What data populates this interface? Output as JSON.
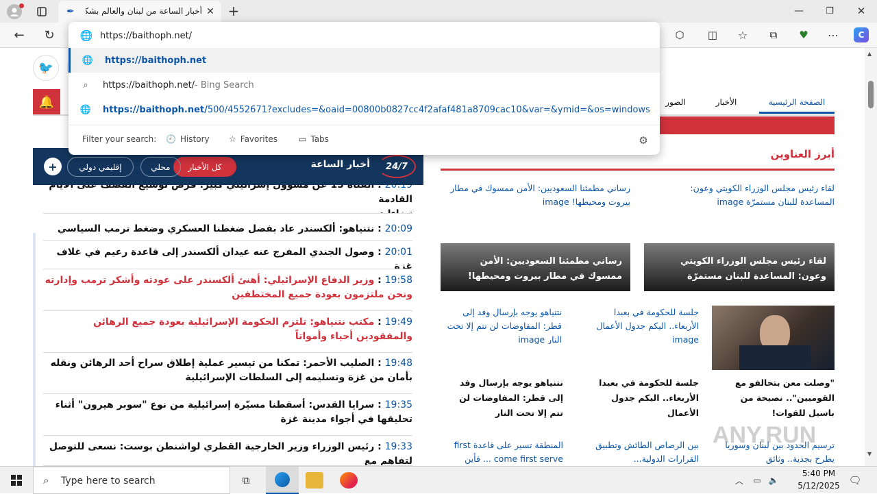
{
  "browser": {
    "tab_title": "أخبار الساعة من لبنان والعالم بشكل",
    "address_value": "https://baithoph.net/"
  },
  "suggestions": [
    {
      "text": "https://baithoph.net",
      "icon": "globe-icon",
      "bold": true
    },
    {
      "text": "https://baithoph.net/",
      "suffix": " - Bing Search",
      "icon": "search-icon"
    },
    {
      "text": "https://baithoph.net/",
      "rest": "500/4552671?excludes=&oaid=00800b0827cc4f2afaf481a8709cac10&var=&ymid=&os=windows&os_v...",
      "icon": "globe-icon"
    }
  ],
  "filter": {
    "label": "Filter your search:",
    "history": "History",
    "favorites": "Favorites",
    "tabs": "Tabs"
  },
  "site": {
    "nav": [
      "الصفحة الرئيسية",
      "الأخبار",
      "الصور"
    ],
    "live_title": "أخبار الساعة",
    "live_badge": "24/7",
    "filters": [
      "كل الأخبار",
      "محلي",
      "إقليمي دولي"
    ],
    "headlines_title": "أبرز العناوين"
  },
  "feed": [
    {
      "time": "20:09",
      "text": "نتنياهو: ألكسندر عاد بفضل ضغطنا العسكري وضغط ترمب السياسي",
      "red": false
    },
    {
      "time": "20:01",
      "text": "وصول الجندي المفرج عنه عيدان ألكسندر إلى قاعدة رعيم في غلاف غزة",
      "red": false
    },
    {
      "time": "19:58",
      "text": "وزير الدفاع الإسرائيلي: أهنئ ألكسندر على عودته وأشكر ترمب وإدارته ونحن ملتزمون بعودة جميع المختطفين",
      "red": true
    },
    {
      "time": "19:49",
      "text": "مكتب نتنياهو: تلتزم الحكومة الإسرائيلية بعودة جميع الرهائن والمفقودين أحياء وأمواتاً",
      "red": true
    },
    {
      "time": "19:48",
      "text": "الصليب الأحمر: تمكنا من تيسير عملية إطلاق سراح أحد الرهائن ونقله بأمان من غزة وتسليمه إلى السلطات الإسرائيلية",
      "red": false
    },
    {
      "time": "19:35",
      "text": "سرايا القدس: أسقطنا مسيّرة إسرائيلية من نوع \"سوبر هيرون\" أثناء تحليقها في أجواء مدينة غزة",
      "red": false
    },
    {
      "time": "19:33",
      "text": "رئيس الوزراء وزير الخارجية القطري لواشنطن بوست: نسعى للتوصل لتفاهم مع",
      "red": false
    }
  ],
  "feed_top": {
    "time": "20:19",
    "text": "القناة 13 عن مسؤول إسرائيلي كبير: فرص توسيع القصف على الأيام القادمة",
    "line2": "تضاءلت"
  },
  "cards": {
    "top_left_broken": "رساني مطمئنا السعوديين: الأمن ممسوك في مطار بيروت ومحيطها! image",
    "top_right_broken": "لقاء رئيس مجلس الوزراء الكويتي وعون: المساعدة للبنان مستمرّة image",
    "top_left_caption": "رساني مطمئنا السعوديين: الأمن ممسوك في مطار بيروت ومحيطها!",
    "top_right_caption": "لقاء رئيس مجلس الوزراء الكويتي وعون: المساعدة للبنان مستمرّة",
    "mid": [
      {
        "broken": "جلسة للحكومة في بعبدا الأربعاء.. اليكم جدول الأعمال image",
        "title": "جلسة للحكومة في بعبدا الأربعاء.. اليكم جدول الأعمال"
      },
      {
        "broken": "نتنياهو يوجه بإرسال وفد إلى قطر: المفاوضات لن تتم إلا تحت النار image",
        "title": "نتنياهو يوجه بإرسال وفد إلى قطر: المفاوضات لن تتم إلا تحت النار"
      }
    ],
    "photo_title": "\"وصلت معن بتحالفو مع القوميين\".. نصيحة من باسيل للقوات!",
    "bottom": [
      {
        "broken": "ترسيم الحدود بين لبنان وسوريا يطرح بجدية.. وثائق"
      },
      {
        "broken": "بين الرصاص الطائش وتطبيق القرارات الدولية..."
      },
      {
        "broken": "المنطقة تسير على قاعدة first come first serve ... فأين"
      }
    ]
  },
  "taskbar": {
    "search_placeholder": "Type here to search",
    "time": "5:40 PM",
    "date": "5/12/2025"
  },
  "watermark": "ANY.RUN"
}
